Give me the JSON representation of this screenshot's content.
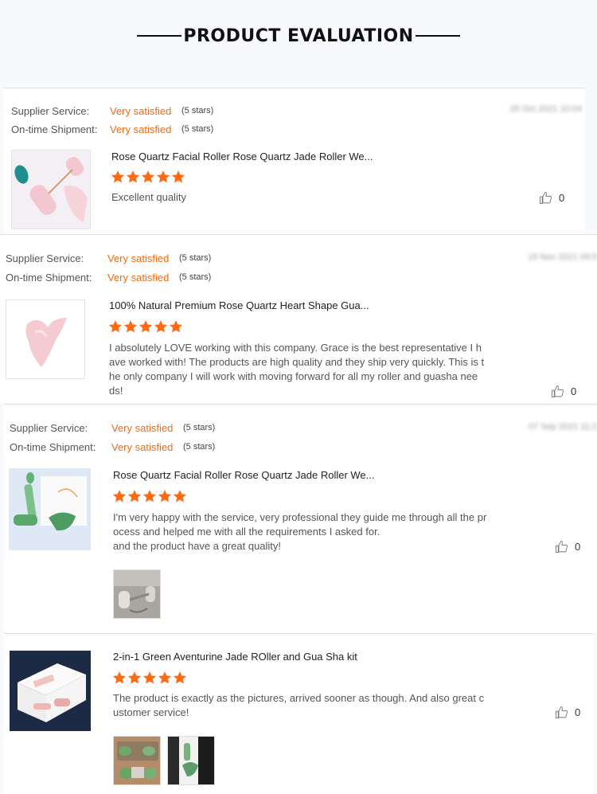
{
  "heading": {
    "title": "PRODUCT EVALUATION"
  },
  "labels": {
    "supplier": "Supplier Service:",
    "shipment": "On-time Shipment:"
  },
  "reviews": [
    {
      "supplier_value": "Very satisfied",
      "supplier_stars": "(5 stars)",
      "shipment_value": "Very satisfied",
      "shipment_stars": "(5 stars)",
      "date": "25 Oct 2021 10:04",
      "product": "Rose Quartz Facial Roller Rose Quartz Jade Roller We...",
      "rating": 5,
      "comment": "Excellent quality",
      "likes": "0"
    },
    {
      "supplier_value": "Very satisfied",
      "supplier_stars": "(5 stars)",
      "shipment_value": "Very satisfied",
      "shipment_stars": "(5 stars)",
      "date": "19 Nov 2021 09:5",
      "product": "100% Natural Premium Rose Quartz Heart Shape Gua...",
      "rating": 5,
      "comment": "I absolutely LOVE working with this company.  Grace is the best representative I h\nave worked with! The products are high quality and they ship very quickly. This is t\nhe only company I will work with moving forward for all my roller and guasha nee\nds!",
      "likes": "0"
    },
    {
      "supplier_value": "Very satisfied",
      "supplier_stars": "(5 stars)",
      "shipment_value": "Very satisfied",
      "shipment_stars": "(5 stars)",
      "date": "07 Sep 2021 11:2",
      "product": "Rose Quartz Facial Roller Rose Quartz Jade Roller We...",
      "rating": 5,
      "comment": "I'm very happy with the service, very professional they guide me through all the pr\nocess and helped me with all the requirements I asked for.\nand the product have a great quality!",
      "likes": "0"
    },
    {
      "product": "2-in-1 Green Aventurine Jade ROller and Gua Sha kit",
      "rating": 5,
      "comment": "The product is exactly as the pictures, arrived sooner as though. And also great c\nustomer service!",
      "likes": "0"
    }
  ],
  "icons": {
    "star": "star-icon",
    "like": "thumbs-up-icon"
  },
  "colors": {
    "accent": "#f26a10",
    "star": "#ff6a13"
  }
}
